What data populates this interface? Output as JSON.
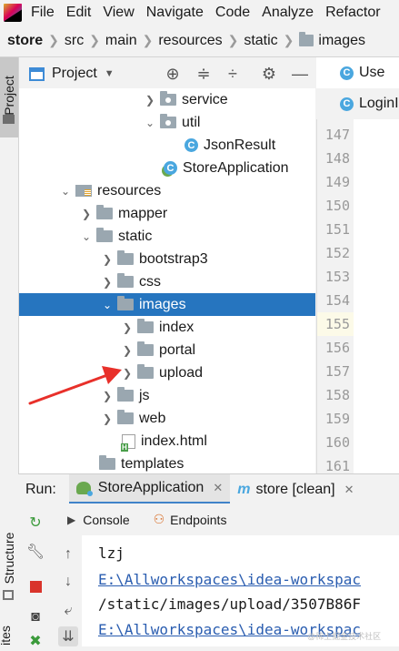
{
  "menu": [
    "File",
    "Edit",
    "View",
    "Navigate",
    "Code",
    "Analyze",
    "Refactor"
  ],
  "breadcrumb": [
    "store",
    "src",
    "main",
    "resources",
    "static",
    "images"
  ],
  "side_tab": "Project",
  "project_panel": {
    "title": "Project"
  },
  "tree": [
    {
      "label": "service",
      "icon": "package-folder-icon",
      "expanded": null
    },
    {
      "label": "util",
      "icon": "package-folder-icon",
      "expanded": true
    },
    {
      "label": "JsonResult",
      "icon": "class-icon",
      "expanded": null
    },
    {
      "label": "StoreApplication",
      "icon": "spring-app-class-icon",
      "expanded": null
    },
    {
      "label": "resources",
      "icon": "resources-folder-icon",
      "expanded": true
    },
    {
      "label": "mapper",
      "icon": "folder-icon",
      "expanded": false
    },
    {
      "label": "static",
      "icon": "folder-icon",
      "expanded": true
    },
    {
      "label": "bootstrap3",
      "icon": "folder-icon",
      "expanded": false
    },
    {
      "label": "css",
      "icon": "folder-icon",
      "expanded": false
    },
    {
      "label": "images",
      "icon": "folder-icon",
      "expanded": true,
      "selected": true
    },
    {
      "label": "index",
      "icon": "folder-icon",
      "expanded": false
    },
    {
      "label": "portal",
      "icon": "folder-icon",
      "expanded": false
    },
    {
      "label": "upload",
      "icon": "folder-icon",
      "expanded": false
    },
    {
      "label": "js",
      "icon": "folder-icon",
      "expanded": false
    },
    {
      "label": "web",
      "icon": "folder-icon",
      "expanded": false
    },
    {
      "label": "index.html",
      "icon": "html-file-icon",
      "expanded": null
    },
    {
      "label": "templates",
      "icon": "folder-icon",
      "expanded": null
    }
  ],
  "editor_tabs": [
    "Use",
    "LoginI"
  ],
  "line_numbers": [
    "147",
    "148",
    "149",
    "150",
    "151",
    "152",
    "153",
    "154",
    "155",
    "156",
    "157",
    "158",
    "159",
    "160",
    "161"
  ],
  "current_line": "155",
  "run": {
    "label": "Run:",
    "tabs": [
      "StoreApplication",
      "store [clean]"
    ],
    "sub_tabs": [
      "Console",
      "Endpoints"
    ]
  },
  "bottom_strip": {
    "structure": "Structure",
    "favorites": "ites"
  },
  "console": [
    {
      "text": "lzj",
      "link": false
    },
    {
      "text": "E:\\Allworkspaces\\idea-workspac",
      "link": true
    },
    {
      "text": "/static/images/upload/3507B86F",
      "link": false
    },
    {
      "text": "E:\\Allworkspaces\\idea-workspac",
      "link": true
    }
  ],
  "watermark": "@稀土掘金技术社区",
  "colors": {
    "selection": "#2675bf",
    "link": "#2a5db0",
    "annotation_arrow": "#e8302a",
    "tab_underline": "#4083c9"
  }
}
